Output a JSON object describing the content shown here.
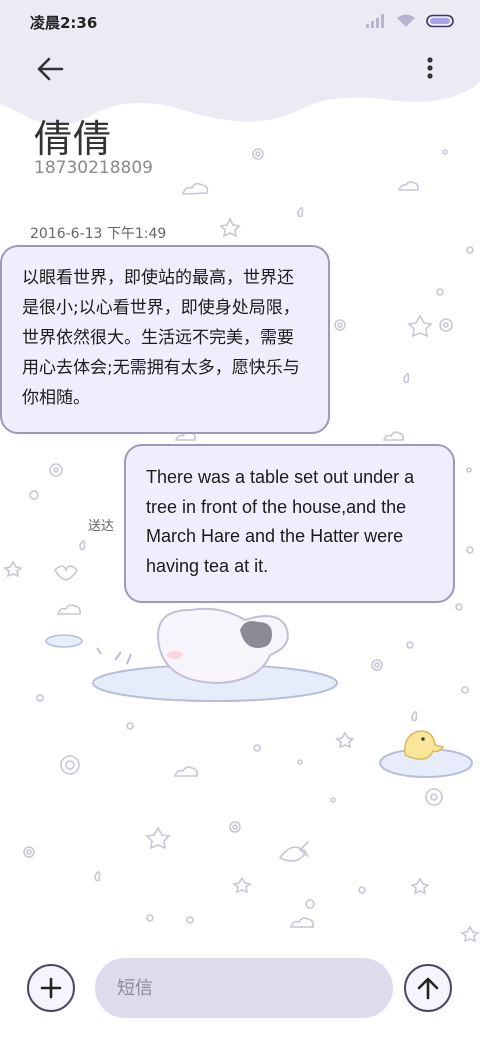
{
  "status_bar": {
    "time": "凌晨2:36",
    "icons": [
      "signal-icon",
      "wifi-icon",
      "battery-icon"
    ]
  },
  "header": {
    "back_icon": "arrow-left-icon",
    "more_icon": "more-vertical-icon"
  },
  "contact": {
    "name": "倩倩",
    "number": "18730218809"
  },
  "conversation": {
    "timestamp": "2016-6-13 下午1:49",
    "messages": [
      {
        "direction": "incoming",
        "text": "以眼看世界，即使站的最高，世界还是很小;以心看世界，即使身处局限，世界依然很大。生活远不完美，需要用心去体会;无需拥有太多，愿快乐与你相随。"
      },
      {
        "direction": "outgoing",
        "text": "There was a table set out under a tree in front of the house,and the March Hare and the Hatter were having tea at it.",
        "status": "送达"
      }
    ]
  },
  "composer": {
    "add_icon": "plus-icon",
    "placeholder": "短信",
    "value": "",
    "send_icon": "arrow-up-icon"
  },
  "colors": {
    "accent": "#9d98bd",
    "bubble_bg": "#efeefc",
    "header_wave": "#ecebf4",
    "input_bg": "#dedbed"
  }
}
